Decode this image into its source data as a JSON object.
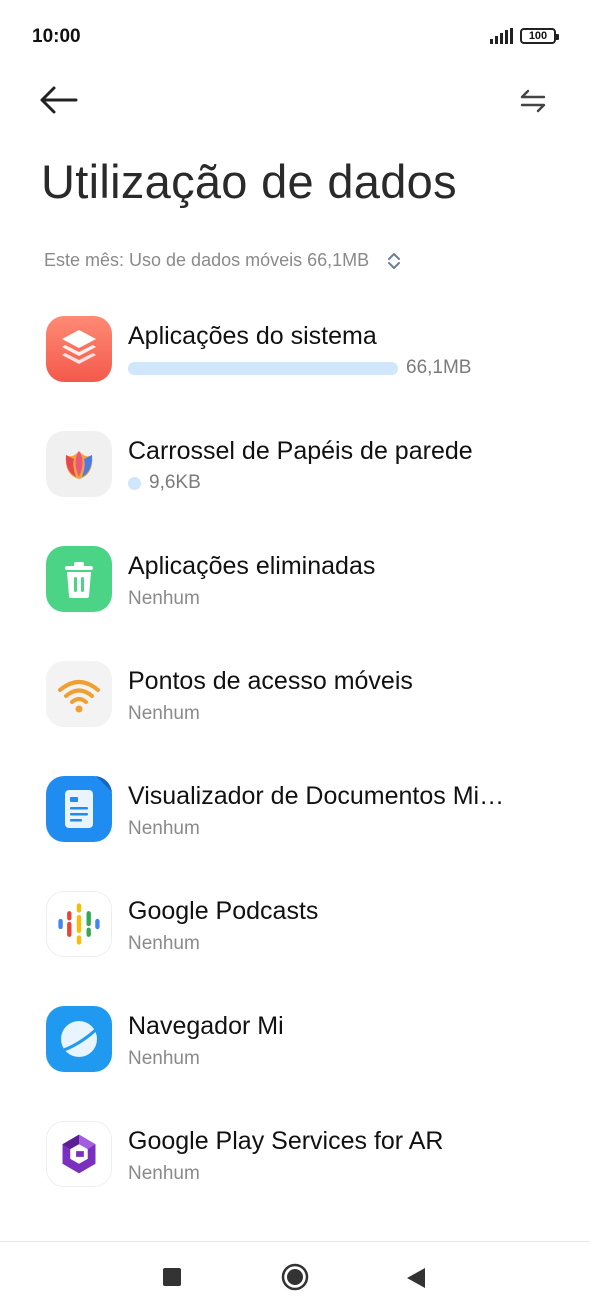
{
  "status_bar": {
    "time": "10:00",
    "battery": "100"
  },
  "header": {
    "title": "Utilização de dados"
  },
  "period": {
    "label": "Este mês: Uso de dados móveis 66,1MB"
  },
  "apps": [
    {
      "name": "Aplicações do sistema",
      "usage": "66,1MB",
      "usage_fraction": 1.0,
      "icon": "system-apps-icon"
    },
    {
      "name": "Carrossel de Papéis de parede",
      "usage": "9,6KB",
      "usage_fraction": 0.0001,
      "icon": "wallpaper-carousel-icon"
    },
    {
      "name": "Aplicações eliminadas",
      "usage": "Nenhum",
      "icon": "trash-icon"
    },
    {
      "name": "Pontos de acesso móveis",
      "usage": "Nenhum",
      "icon": "hotspot-icon"
    },
    {
      "name": "Visualizador de Documentos Mi…",
      "usage": "Nenhum",
      "icon": "document-viewer-icon"
    },
    {
      "name": "Google Podcasts",
      "usage": "Nenhum",
      "icon": "podcasts-icon"
    },
    {
      "name": "Navegador Mi",
      "usage": "Nenhum",
      "icon": "browser-icon"
    },
    {
      "name": "Google Play Services for AR",
      "usage": "Nenhum",
      "icon": "ar-services-icon"
    }
  ],
  "colors": {
    "usage_bar": "#cfe6fb",
    "accent": "#8a8a8a"
  }
}
